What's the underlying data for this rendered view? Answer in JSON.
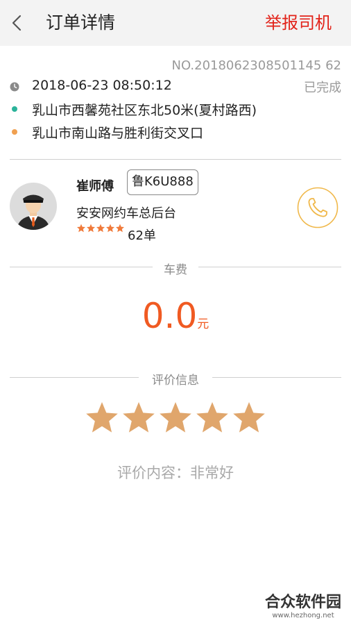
{
  "header": {
    "title": "订单详情",
    "report_label": "举报司机",
    "back_icon": "chevron-left-icon"
  },
  "order": {
    "number": "NO.2018062308501145 62",
    "time": "2018-06-23 08:50:12",
    "status": "已完成",
    "start_address": "乳山市西馨苑社区东北50米(夏村路西)",
    "end_address": "乳山市南山路与胜利街交叉口"
  },
  "driver": {
    "name": "崔师傅",
    "plate": "鲁K6U888",
    "company": "安安网约车总后台",
    "rating_stars": 5,
    "order_count": "62单"
  },
  "fare": {
    "section_title": "车费",
    "value": "0.0",
    "unit": "元"
  },
  "rating": {
    "section_title": "评价信息",
    "stars": 5,
    "comment_label": "评价内容：",
    "comment_value": "非常好"
  },
  "watermark": {
    "title": "合众软件园",
    "url": "www.hezhong.net"
  },
  "colors": {
    "accent_red": "#e2231a",
    "fare_orange": "#f05a22",
    "star_tan": "#e0a66c",
    "start_dot": "#2bb39a",
    "end_dot": "#f0a050",
    "call_circle": "#f0b84a"
  }
}
